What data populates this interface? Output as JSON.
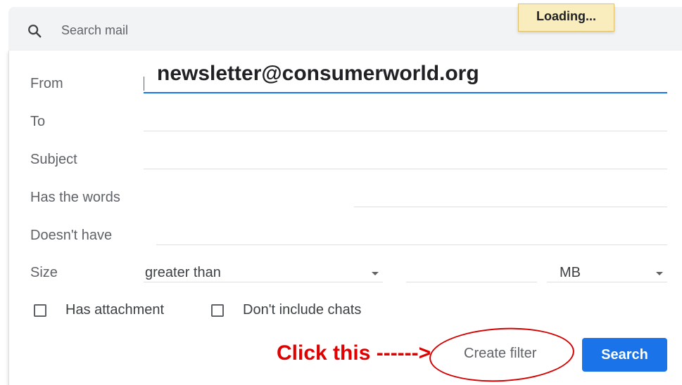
{
  "search": {
    "placeholder": "Search mail"
  },
  "loading": "Loading...",
  "form": {
    "from_label": "From",
    "from_value": "newsletter@consumerworld.org",
    "to_label": "To",
    "subject_label": "Subject",
    "has_words_label": "Has the words",
    "doesnt_have_label": "Doesn't have",
    "size_label": "Size",
    "size_comparator": "greater than",
    "size_unit": "MB",
    "has_attachment_label": "Has attachment",
    "no_chats_label": "Don't include chats"
  },
  "annotation": "Click this ------>",
  "buttons": {
    "create_filter": "Create filter",
    "search": "Search"
  },
  "colors": {
    "accent": "#1a73e8",
    "annotation": "#e00000"
  }
}
